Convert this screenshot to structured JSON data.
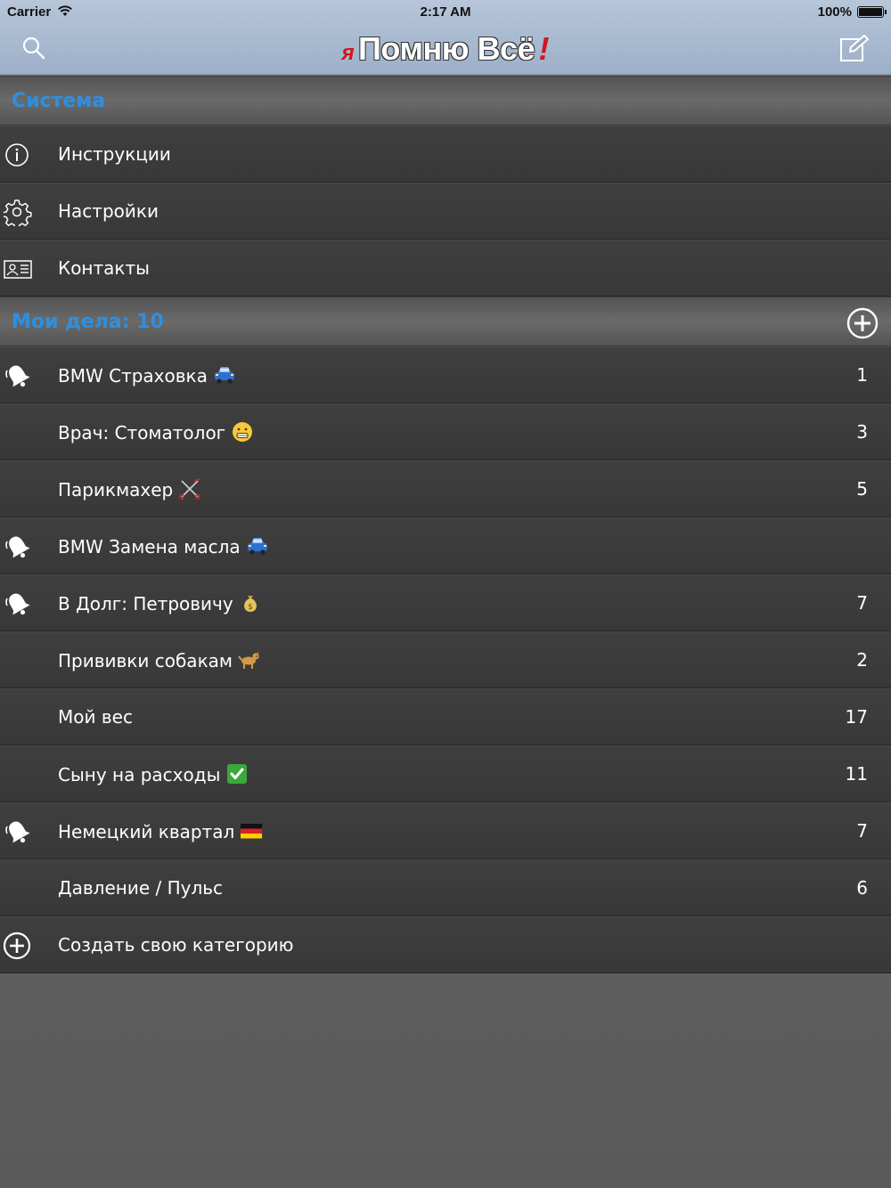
{
  "status_bar": {
    "carrier": "Carrier",
    "time": "2:17 AM",
    "battery": "100%"
  },
  "nav": {
    "title_prefix": "я",
    "title_main": "Помню Всё",
    "title_suffix": "!",
    "left_icon": "search-icon",
    "right_icon": "compose-icon"
  },
  "system_section": {
    "header": "Система",
    "items": [
      {
        "label": "Инструкции",
        "icon": "info-icon"
      },
      {
        "label": "Настройки",
        "icon": "gear-icon"
      },
      {
        "label": "Контакты",
        "icon": "contact-card-icon"
      }
    ]
  },
  "tasks_section": {
    "header": "Мои дела: 10",
    "add_icon": "plus-circle-icon",
    "items": [
      {
        "label": "BMW Страховка",
        "emoji": "car-emoji",
        "count": "1",
        "bell": true
      },
      {
        "label": "Врач: Стоматолог",
        "emoji": "grimace-face-emoji",
        "count": "3",
        "bell": false
      },
      {
        "label": "Парикмахер",
        "emoji": "scissors-emoji",
        "count": "5",
        "bell": false
      },
      {
        "label": "BMW Замена масла",
        "emoji": "car-emoji",
        "count": "",
        "bell": true
      },
      {
        "label": "В Долг: Петровичу",
        "emoji": "money-bag-emoji",
        "count": "7",
        "bell": true
      },
      {
        "label": "Прививки собакам",
        "emoji": "dog-emoji",
        "count": "2",
        "bell": false
      },
      {
        "label": "Мой вес",
        "emoji": "",
        "count": "17",
        "bell": false
      },
      {
        "label": "Сыну на расходы",
        "emoji": "check-mark-emoji",
        "count": "11",
        "bell": false
      },
      {
        "label": "Немецкий квартал",
        "emoji": "german-flag-emoji",
        "count": "7",
        "bell": true
      },
      {
        "label": "Давление / Пульс",
        "emoji": "",
        "count": "6",
        "bell": false
      }
    ],
    "create_label": "Создать свою категорию"
  },
  "colors": {
    "nav_bar": "#a9bbd1",
    "section_header_text": "#2e8fe0",
    "row_background": "#3c3c3c",
    "title_accent": "#d4151b"
  }
}
